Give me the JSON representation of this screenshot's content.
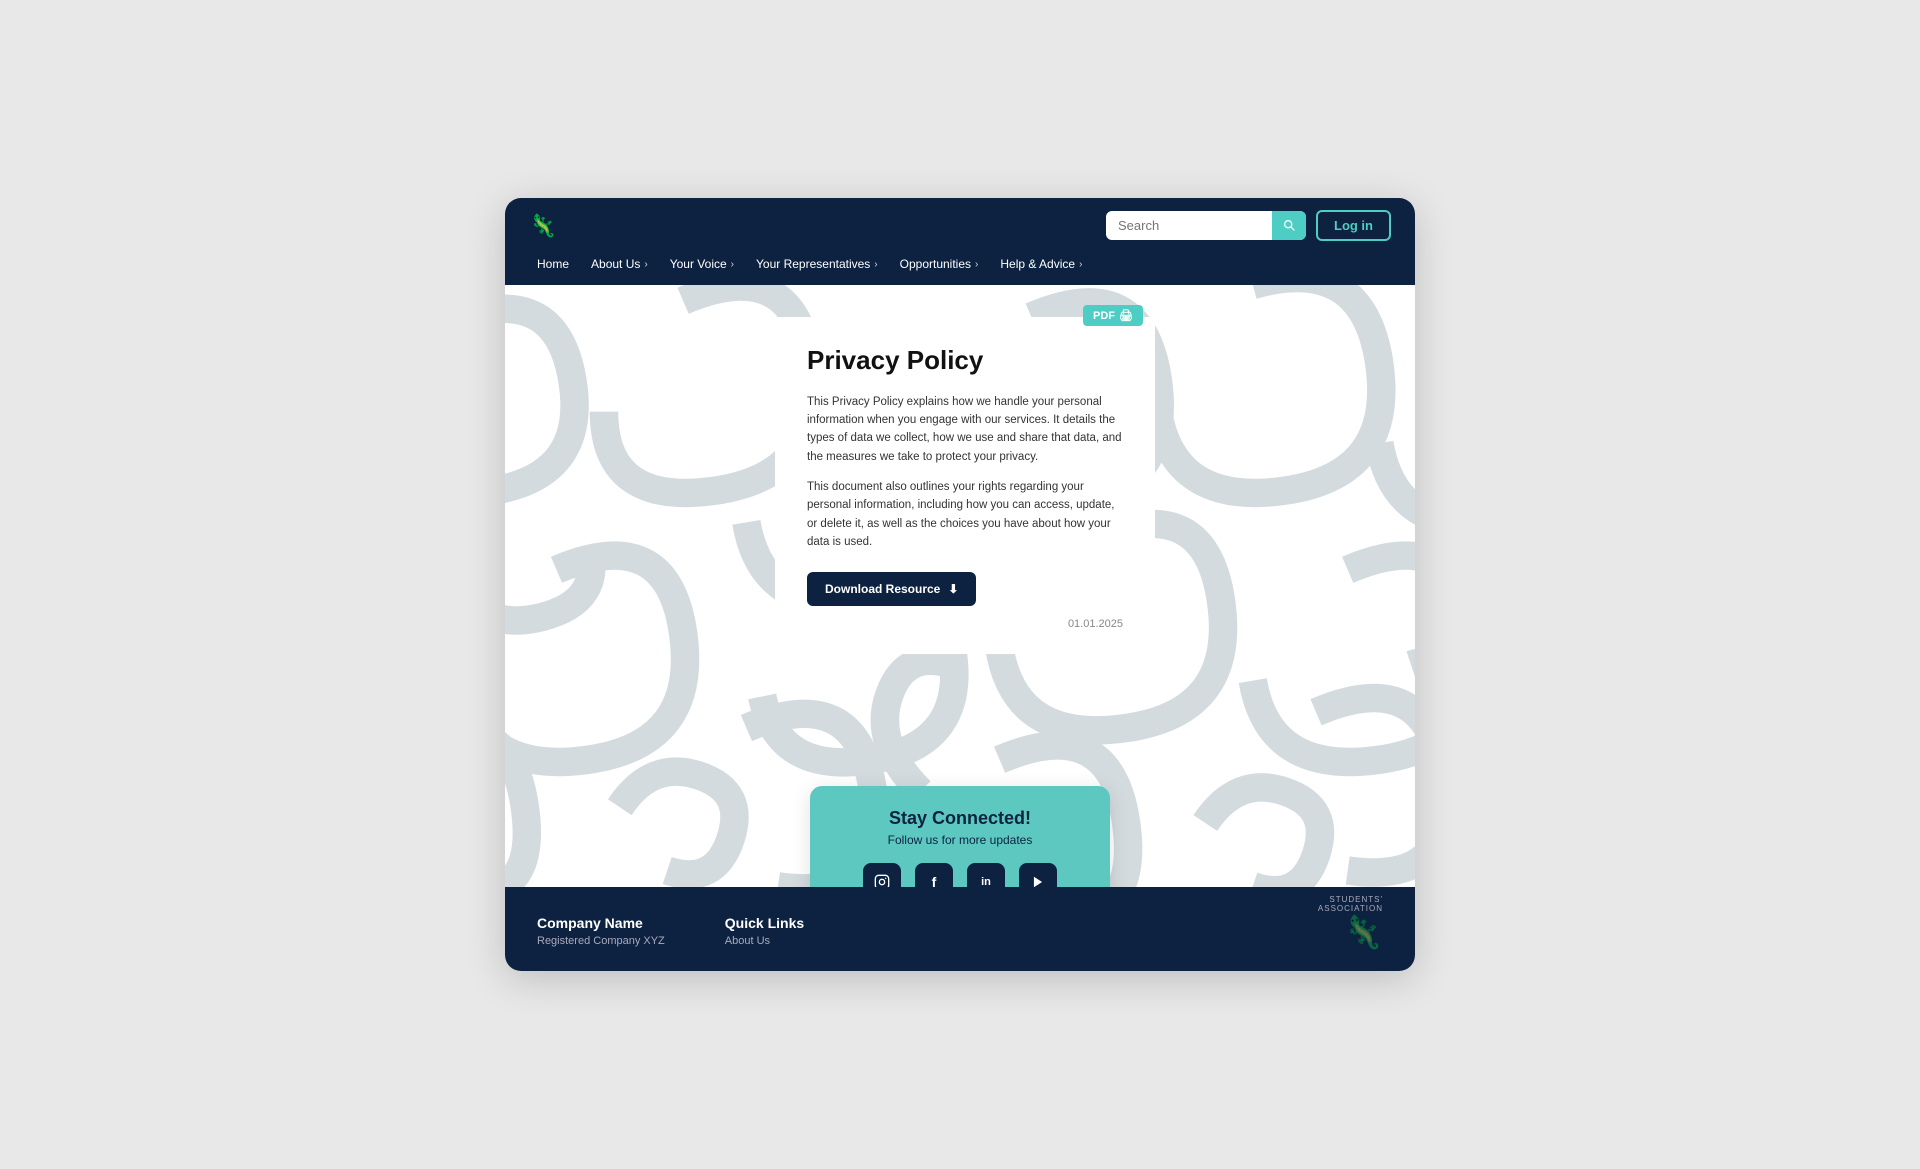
{
  "navbar": {
    "logo_icon": "🦎",
    "search_placeholder": "Search",
    "search_icon": "🔍",
    "login_label": "Log in",
    "nav_items": [
      {
        "label": "Home",
        "has_chevron": false
      },
      {
        "label": "About Us",
        "has_chevron": true
      },
      {
        "label": "Your Voice",
        "has_chevron": true
      },
      {
        "label": "Your Representatives",
        "has_chevron": true
      },
      {
        "label": "Opportunities",
        "has_chevron": true
      },
      {
        "label": "Help & Advice",
        "has_chevron": true
      }
    ]
  },
  "pdf_badge": {
    "label": "PDF",
    "icon": "📄"
  },
  "content": {
    "title": "Privacy Policy",
    "paragraph1": "This Privacy Policy explains how we handle your personal information when you engage with our services. It details the types of data we collect, how we use and share that data, and the measures we take to protect your privacy.",
    "paragraph2": "This document also outlines your rights regarding your personal information, including how you can access, update, or delete it, as well as the choices you have about how your data is used.",
    "download_label": "Download Resource",
    "download_icon": "⬇",
    "date": "01.01.2025"
  },
  "social": {
    "title": "Stay Connected!",
    "subtitle": "Follow us for more updates",
    "icons": [
      {
        "name": "instagram",
        "symbol": "📷"
      },
      {
        "name": "facebook",
        "symbol": "f"
      },
      {
        "name": "linkedin",
        "symbol": "in"
      },
      {
        "name": "youtube",
        "symbol": "▶"
      }
    ]
  },
  "footer": {
    "company_name": "Company Name",
    "company_sub": "Registered Company XYZ",
    "quick_links_title": "Quick Links",
    "quick_links_sub": "About Us",
    "logo_label": "STUDENTS'\nASSOCIATION"
  }
}
